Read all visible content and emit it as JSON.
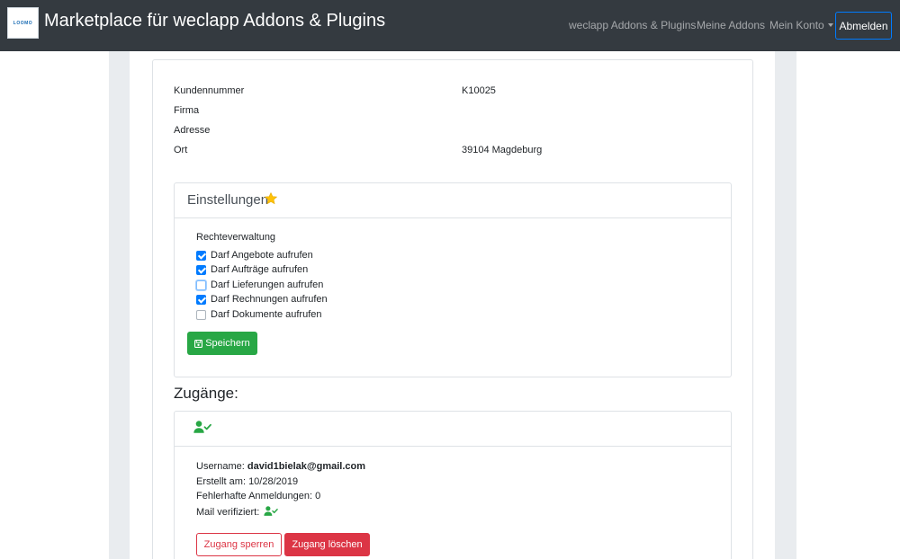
{
  "navbar": {
    "logo_text": "LOOMO",
    "brand": "Marketplace für weclapp Addons & Plugins",
    "links": [
      {
        "label": "weclapp Addons & Plugins"
      },
      {
        "label": "Meine Addons"
      },
      {
        "label": "Mein Konto"
      }
    ],
    "logout_label": "Abmelden"
  },
  "customer": {
    "rows": [
      {
        "label": "Kundennummer",
        "value": "K10025"
      },
      {
        "label": "Firma",
        "value": ""
      },
      {
        "label": "Adresse",
        "value": ""
      },
      {
        "label": "Ort",
        "value": "39104 Magdeburg"
      }
    ]
  },
  "settings": {
    "title": "Einstellungen",
    "icon": "star-icon",
    "section_label": "Rechteverwaltung",
    "permissions": [
      {
        "label": "Darf Angebote aufrufen",
        "checked": true
      },
      {
        "label": "Darf Aufträge aufrufen",
        "checked": true
      },
      {
        "label": "Darf Lieferungen aufrufen",
        "checked": false,
        "focused": true
      },
      {
        "label": "Darf Rechnungen aufrufen",
        "checked": true
      },
      {
        "label": "Darf Dokumente aufrufen",
        "checked": false
      }
    ],
    "save_label": "Speichern"
  },
  "access": {
    "heading": "Zugänge:",
    "header_icon": "user-check-icon",
    "username_label": "Username:",
    "username": "david1bielak@gmail.com",
    "created": "Erstellt am: 10/28/2019",
    "failed_logins": "Fehlerhafte Anmeldungen: 0",
    "mail_verified_label": "Mail verifiziert:",
    "lock_label": "Zugang sperren",
    "delete_label": "Zugang löschen"
  },
  "colors": {
    "navbar": "#343a40",
    "primary": "#007bff",
    "success": "#28a745",
    "danger": "#dc3545",
    "star": "#ffc107",
    "verified": "#28a745"
  }
}
